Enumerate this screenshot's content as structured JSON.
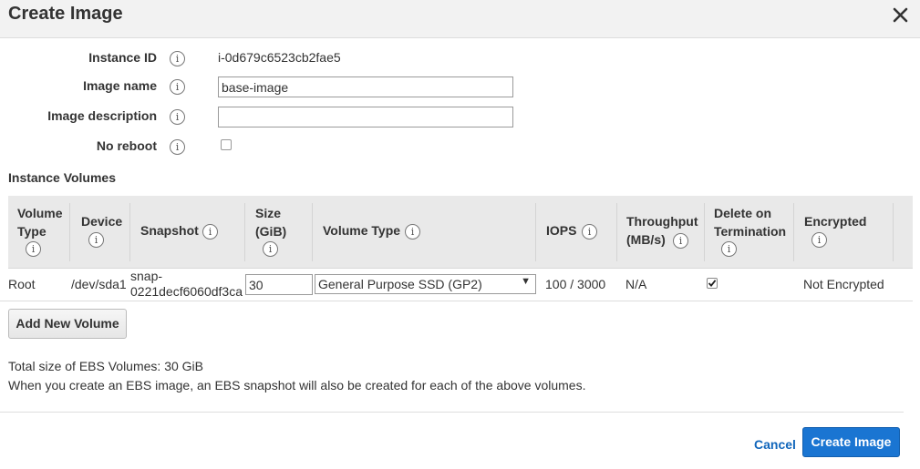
{
  "dialog": {
    "title": "Create Image",
    "close_icon": "close-icon"
  },
  "form": {
    "instance_id_label": "Instance ID",
    "instance_id_value": "i-0d679c6523cb2fae5",
    "image_name_label": "Image name",
    "image_name_value": "base-image",
    "image_description_label": "Image description",
    "image_description_value": "",
    "no_reboot_label": "No reboot",
    "no_reboot_checked": false,
    "info_icon_glyph": "i"
  },
  "volumes": {
    "section_title": "Instance Volumes",
    "headers": {
      "volume_type": [
        "Volume",
        "Type"
      ],
      "device": "Device",
      "snapshot": "Snapshot",
      "size": [
        "Size",
        "(GiB)"
      ],
      "volume_type_col": "Volume Type",
      "iops": "IOPS",
      "throughput": [
        "Throughput",
        "(MB/s)"
      ],
      "delete_on_termination": [
        "Delete on",
        "Termination"
      ],
      "encrypted": "Encrypted"
    },
    "rows": [
      {
        "volume_type": "Root",
        "device": "/dev/sda1",
        "snapshot": [
          "snap-",
          "0221decf6060df3ca"
        ],
        "size": "30",
        "volume_type_value": "General Purpose SSD (GP2)",
        "iops": "100 / 3000",
        "throughput": "N/A",
        "delete_on_termination": true,
        "encrypted": "Not Encrypted"
      }
    ],
    "add_button_label": "Add New Volume"
  },
  "summary": {
    "total_size": "Total size of EBS Volumes: 30 GiB",
    "note": "When you create an EBS image, an EBS snapshot will also be created for each of the above volumes."
  },
  "footer": {
    "cancel_label": "Cancel",
    "create_label": "Create Image"
  },
  "colors": {
    "primary": "#1a75d2",
    "link": "#1166bb",
    "header_bg": "#f2f2f2",
    "table_header_bg": "#e9e9e9"
  }
}
